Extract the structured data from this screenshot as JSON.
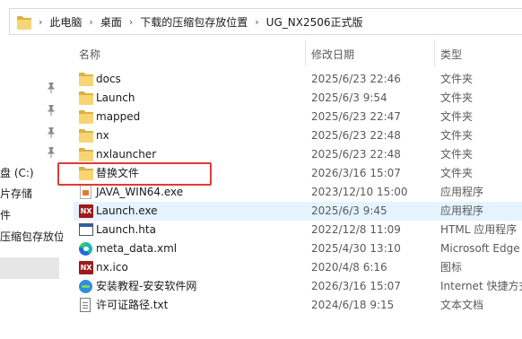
{
  "breadcrumb": [
    "此电脑",
    "桌面",
    "下载的压缩包存放位置",
    "UG_NX2506正式版"
  ],
  "nav": {
    "items": [
      "盘 (C:)",
      "片存储",
      "件",
      "压缩包存放位"
    ]
  },
  "columns": {
    "name": "名称",
    "date": "修改日期",
    "type": "类型"
  },
  "files": [
    {
      "name": "docs",
      "date": "2025/6/23 22:46",
      "type": "文件夹",
      "icon": "folder-icon"
    },
    {
      "name": "Launch",
      "date": "2025/6/3 9:54",
      "type": "文件夹",
      "icon": "folder-icon"
    },
    {
      "name": "mapped",
      "date": "2025/6/23 22:47",
      "type": "文件夹",
      "icon": "folder-icon"
    },
    {
      "name": "nx",
      "date": "2025/6/23 22:48",
      "type": "文件夹",
      "icon": "folder-icon"
    },
    {
      "name": "nxlauncher",
      "date": "2025/6/23 22:48",
      "type": "文件夹",
      "icon": "folder-icon"
    },
    {
      "name": "替换文件",
      "date": "2026/3/16 15:07",
      "type": "文件夹",
      "icon": "folder-icon"
    },
    {
      "name": "JAVA_WIN64.exe",
      "date": "2023/12/10 15:00",
      "type": "应用程序",
      "icon": "java-exe-icon"
    },
    {
      "name": "Launch.exe",
      "date": "2025/6/3 9:45",
      "type": "应用程序",
      "icon": "nx-icon"
    },
    {
      "name": "Launch.hta",
      "date": "2022/12/8 11:09",
      "type": "HTML 应用程序",
      "icon": "hta-icon"
    },
    {
      "name": "meta_data.xml",
      "date": "2025/4/30 13:10",
      "type": "Microsoft Edge",
      "icon": "edge-icon"
    },
    {
      "name": "nx.ico",
      "date": "2020/4/8 6:16",
      "type": "图标",
      "icon": "nx-icon"
    },
    {
      "name": "安装教程-安安软件网",
      "date": "2026/3/16 15:07",
      "type": "Internet 快捷方式",
      "icon": "internet-shortcut-icon"
    },
    {
      "name": "许可证路径.txt",
      "date": "2024/6/18 9:15",
      "type": "文本文档",
      "icon": "text-file-icon"
    }
  ],
  "nx_icon_text": "NX",
  "colors": {
    "highlight": "#e53935",
    "hover_row": "#e5f3ff",
    "folder": "#f8d574"
  }
}
